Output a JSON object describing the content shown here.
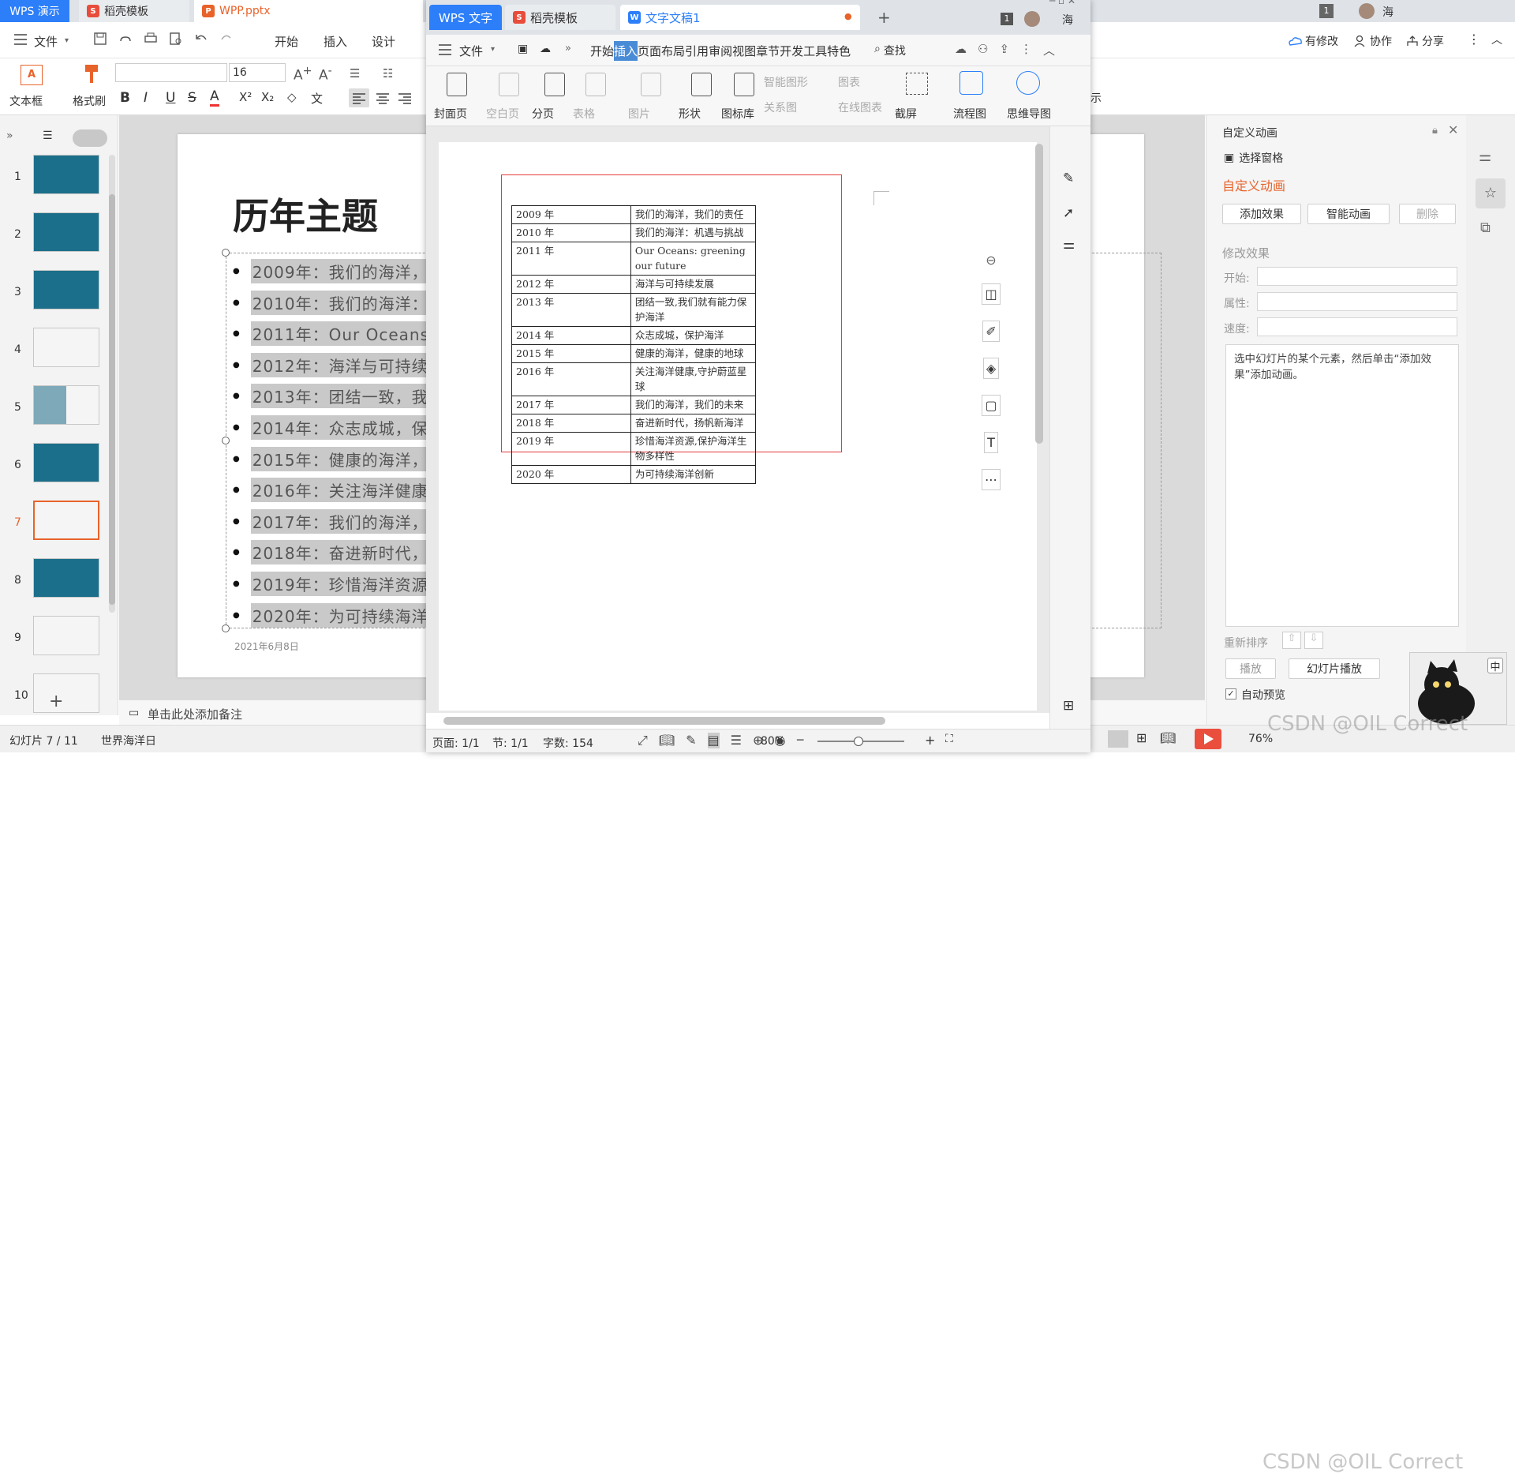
{
  "main_window": {
    "tabs": [
      {
        "label": "WPS 演示"
      },
      {
        "label": "稻壳模板"
      },
      {
        "label": "WPP.pptx"
      }
    ],
    "menu": {
      "file": "文件",
      "items": [
        "开始",
        "插入",
        "设计"
      ]
    },
    "right_actions": {
      "changes": "有修改",
      "collab": "协作",
      "share": "分享"
    },
    "user": "海",
    "badge": "1",
    "ribbon": {
      "textbox": "文本框",
      "format_painter": "格式刷",
      "font_size": "16",
      "bold": "B",
      "italic": "I",
      "underline": "U",
      "strike": "S",
      "show": "示"
    },
    "slides": [
      {
        "num": "1"
      },
      {
        "num": "2"
      },
      {
        "num": "3"
      },
      {
        "num": "4"
      },
      {
        "num": "5"
      },
      {
        "num": "6"
      },
      {
        "num": "7"
      },
      {
        "num": "8"
      },
      {
        "num": "9"
      },
      {
        "num": "10"
      }
    ],
    "slide": {
      "title": "历年主题",
      "bullets": [
        "2009年：我们的海洋，",
        "2010年：我们的海洋：",
        "2011年：Our Oceans",
        "2012年：海洋与可持续",
        "2013年：团结一致，我",
        "2014年：众志成城，保",
        "2015年：健康的海洋，",
        "2016年：关注海洋健康",
        "2017年：我们的海洋，",
        "2018年：奋进新时代，",
        "2019年：珍惜海洋资源",
        "2020年：为可持续海洋"
      ],
      "date": "2021年6月8日"
    },
    "notes_placeholder": "单击此处添加备注",
    "status": {
      "slide": "幻灯片 7 / 11",
      "theme": "世界海洋日",
      "zoom": "76%"
    },
    "anim_pane": {
      "title": "自定义动画",
      "select_pane": "选择窗格",
      "section": "自定义动画",
      "add_effect": "添加效果",
      "smart_anim": "智能动画",
      "delete": "删除",
      "modify": "修改效果",
      "start": "开始:",
      "property": "属性:",
      "speed": "速度:",
      "hint": "选中幻灯片的某个元素，然后单击“添加效果”添加动画。",
      "reorder": "重新排序",
      "play": "播放",
      "slideshow": "幻灯片播放",
      "auto_preview": "自动预览",
      "ime": "中"
    },
    "watermark": "CSDN @OIL Correct"
  },
  "writer": {
    "tabs": [
      {
        "label": "WPS 文字"
      },
      {
        "label": "稻壳模板"
      },
      {
        "label": "文字文稿1"
      }
    ],
    "badge": "1",
    "user": "海",
    "menu": {
      "file": "文件",
      "items": [
        "开始",
        "插入",
        "页面布局",
        "引用",
        "审阅",
        "视图",
        "章节",
        "开发工具",
        "特色"
      ],
      "search": "查找"
    },
    "ribbon": [
      {
        "label": "封面页"
      },
      {
        "label": "空白页"
      },
      {
        "label": "分页"
      },
      {
        "label": "表格"
      },
      {
        "label": "图片"
      },
      {
        "label": "形状"
      },
      {
        "label": "图标库"
      }
    ],
    "ribbon_small": {
      "smart_shape": "智能图形",
      "chart": "图表",
      "relation": "关系图",
      "online_chart": "在线图表"
    },
    "ribbon_right": {
      "screenshot": "截屏",
      "flowchart": "流程图",
      "mindmap": "思维导图"
    },
    "table": [
      [
        "2009 年",
        "我们的海洋，我们的责任"
      ],
      [
        "2010 年",
        "我们的海洋：机遇与挑战"
      ],
      [
        "2011 年",
        "Our Oceans: greening our future"
      ],
      [
        "2012 年",
        "海洋与可持续发展"
      ],
      [
        "2013 年",
        "团结一致,我们就有能力保护海洋"
      ],
      [
        "2014 年",
        "众志成城，保护海洋"
      ],
      [
        "2015 年",
        "健康的海洋，健康的地球"
      ],
      [
        "2016 年",
        "关注海洋健康,守护蔚蓝星球"
      ],
      [
        "2017 年",
        "我们的海洋，我们的未来"
      ],
      [
        "2018 年",
        "奋进新时代，扬帆新海洋"
      ],
      [
        "2019 年",
        "珍惜海洋资源,保护海洋生物多样性"
      ],
      [
        "2020 年",
        "为可持续海洋创新"
      ]
    ],
    "status": {
      "page": "页面: 1/1",
      "section": "节: 1/1",
      "words": "字数: 154",
      "zoom": "80%"
    }
  },
  "colors": {
    "accent_blue": "#2d7ff9",
    "orange": "#e8632a",
    "selection_red": "#e33b3b"
  }
}
